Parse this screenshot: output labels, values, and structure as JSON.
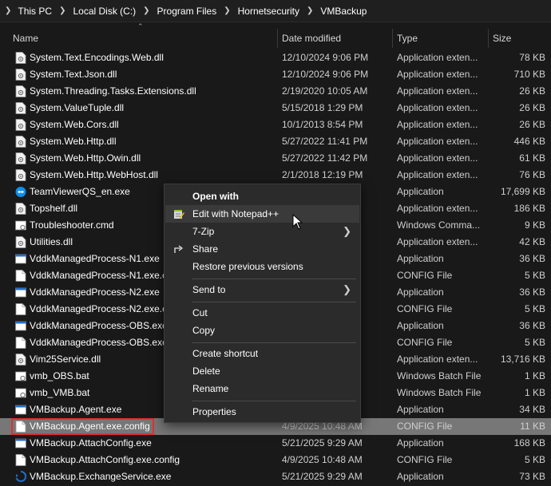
{
  "address_bar": {
    "crumbs": [
      "This PC",
      "Local Disk (C:)",
      "Program Files",
      "Hornetsecurity",
      "VMBackup"
    ]
  },
  "columns": {
    "name": "Name",
    "date": "Date modified",
    "type": "Type",
    "size": "Size"
  },
  "files": [
    {
      "name": "System.Text.Encodings.Web.dll",
      "date": "12/10/2024 9:06 PM",
      "type": "Application exten...",
      "size": "78 KB",
      "icon": "dll-icon"
    },
    {
      "name": "System.Text.Json.dll",
      "date": "12/10/2024 9:06 PM",
      "type": "Application exten...",
      "size": "710 KB",
      "icon": "dll-icon"
    },
    {
      "name": "System.Threading.Tasks.Extensions.dll",
      "date": "2/19/2020 10:05 AM",
      "type": "Application exten...",
      "size": "26 KB",
      "icon": "dll-icon"
    },
    {
      "name": "System.ValueTuple.dll",
      "date": "5/15/2018 1:29 PM",
      "type": "Application exten...",
      "size": "26 KB",
      "icon": "dll-icon"
    },
    {
      "name": "System.Web.Cors.dll",
      "date": "10/1/2013 8:54 PM",
      "type": "Application exten...",
      "size": "26 KB",
      "icon": "dll-icon"
    },
    {
      "name": "System.Web.Http.dll",
      "date": "5/27/2022 11:41 PM",
      "type": "Application exten...",
      "size": "446 KB",
      "icon": "dll-icon"
    },
    {
      "name": "System.Web.Http.Owin.dll",
      "date": "5/27/2022 11:42 PM",
      "type": "Application exten...",
      "size": "61 KB",
      "icon": "dll-icon"
    },
    {
      "name": "System.Web.Http.WebHost.dll",
      "date": "2/1/2018 12:19 PM",
      "type": "Application exten...",
      "size": "76 KB",
      "icon": "dll-icon"
    },
    {
      "name": "TeamViewerQS_en.exe",
      "date": "M",
      "type": "Application",
      "size": "17,699 KB",
      "icon": "teamviewer-icon"
    },
    {
      "name": "Topshelf.dll",
      "date": "",
      "type": "Application exten...",
      "size": "186 KB",
      "icon": "dll-icon"
    },
    {
      "name": "Troubleshooter.cmd",
      "date": "",
      "type": "Windows Comma...",
      "size": "9 KB",
      "icon": "cmd-icon"
    },
    {
      "name": "Utilities.dll",
      "date": "",
      "type": "Application exten...",
      "size": "42 KB",
      "icon": "dll-icon"
    },
    {
      "name": "VddkManagedProcess-N1.exe",
      "date": "",
      "type": "Application",
      "size": "36 KB",
      "icon": "exe-icon"
    },
    {
      "name": "VddkManagedProcess-N1.exe.co",
      "date": "",
      "type": "CONFIG File",
      "size": "5 KB",
      "icon": "config-icon"
    },
    {
      "name": "VddkManagedProcess-N2.exe",
      "date": "",
      "type": "Application",
      "size": "36 KB",
      "icon": "exe-icon"
    },
    {
      "name": "VddkManagedProcess-N2.exe.co",
      "date": "",
      "type": "CONFIG File",
      "size": "5 KB",
      "icon": "config-icon"
    },
    {
      "name": "VddkManagedProcess-OBS.exe",
      "date": "",
      "type": "Application",
      "size": "36 KB",
      "icon": "exe-icon"
    },
    {
      "name": "VddkManagedProcess-OBS.exe.",
      "date": "",
      "type": "CONFIG File",
      "size": "5 KB",
      "icon": "config-icon"
    },
    {
      "name": "Vim25Service.dll",
      "date": "",
      "type": "Application exten...",
      "size": "13,716 KB",
      "icon": "dll-icon"
    },
    {
      "name": "vmb_OBS.bat",
      "date": "AM",
      "type": "Windows Batch File",
      "size": "1 KB",
      "icon": "bat-icon"
    },
    {
      "name": "vmb_VMB.bat",
      "date": "",
      "type": "Windows Batch File",
      "size": "1 KB",
      "icon": "bat-icon"
    },
    {
      "name": "VMBackup.Agent.exe",
      "date": "",
      "type": "Application",
      "size": "34 KB",
      "icon": "exe-icon"
    },
    {
      "name": "VMBackup.Agent.exe.config",
      "date": "4/9/2025 10:48 AM",
      "type": "CONFIG File",
      "size": "11 KB",
      "icon": "config-icon",
      "selected": true
    },
    {
      "name": "VMBackup.AttachConfig.exe",
      "date": "5/21/2025 9:29 AM",
      "type": "Application",
      "size": "168 KB",
      "icon": "exe-icon"
    },
    {
      "name": "VMBackup.AttachConfig.exe.config",
      "date": "4/9/2025 10:48 AM",
      "type": "CONFIG File",
      "size": "5 KB",
      "icon": "config-icon"
    },
    {
      "name": "VMBackup.ExchangeService.exe",
      "date": "5/21/2025 9:29 AM",
      "type": "Application",
      "size": "73 KB",
      "icon": "exchange-icon"
    }
  ],
  "context_menu": {
    "open_with": "Open with",
    "edit_notepad": "Edit with Notepad++",
    "zip": "7-Zip",
    "share": "Share",
    "restore": "Restore previous versions",
    "send_to": "Send to",
    "cut": "Cut",
    "copy": "Copy",
    "create_shortcut": "Create shortcut",
    "delete": "Delete",
    "rename": "Rename",
    "properties": "Properties"
  },
  "colors": {
    "selection": "#777777",
    "highlight_border": "#e03030",
    "menu_bg": "#2b2b2b"
  }
}
